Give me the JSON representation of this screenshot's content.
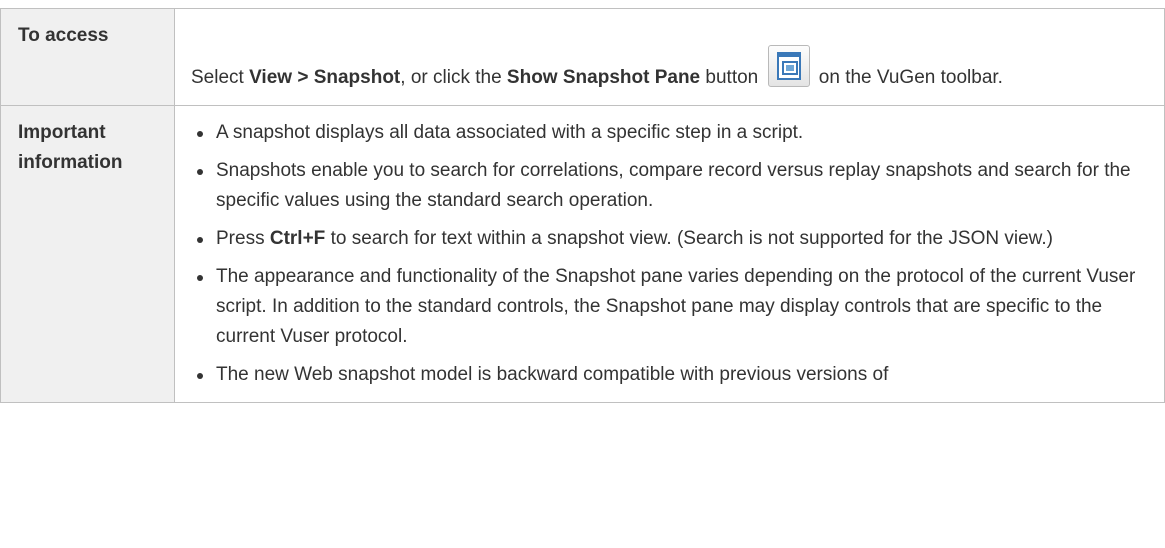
{
  "access": {
    "label": "To access",
    "text_1": "Select ",
    "menu_path": "View > Snapshot",
    "text_2": ", or click the ",
    "button_name": "Show Snapshot Pane",
    "text_3": " button",
    "text_4": " on the VuGen toolbar.",
    "icon": "show-snapshot-pane-icon"
  },
  "info": {
    "label": "Important information",
    "bullets": [
      "A snapshot displays all data associated with a specific step in a script.",
      "Snapshots enable you to search for correlations, compare record versus replay snapshots and search for the specific values using the standard search operation.",
      "The appearance and functionality of the Snapshot pane varies depending on the protocol of the current Vuser script. In addition to the standard controls, the Snapshot pane may display controls that are specific to the current Vuser protocol.",
      "The new Web snapshot model is backward compatible with previous versions of"
    ],
    "search_bullet": {
      "before": "Press ",
      "shortcut": "Ctrl+F",
      "after": " to search for text within a snapshot view. (Search is not supported for the JSON view.)"
    }
  },
  "colors": {
    "label_bg": "#f0f0f0",
    "border": "#c0c0c0",
    "text": "#333333",
    "icon_blue": "#3a78b8"
  }
}
